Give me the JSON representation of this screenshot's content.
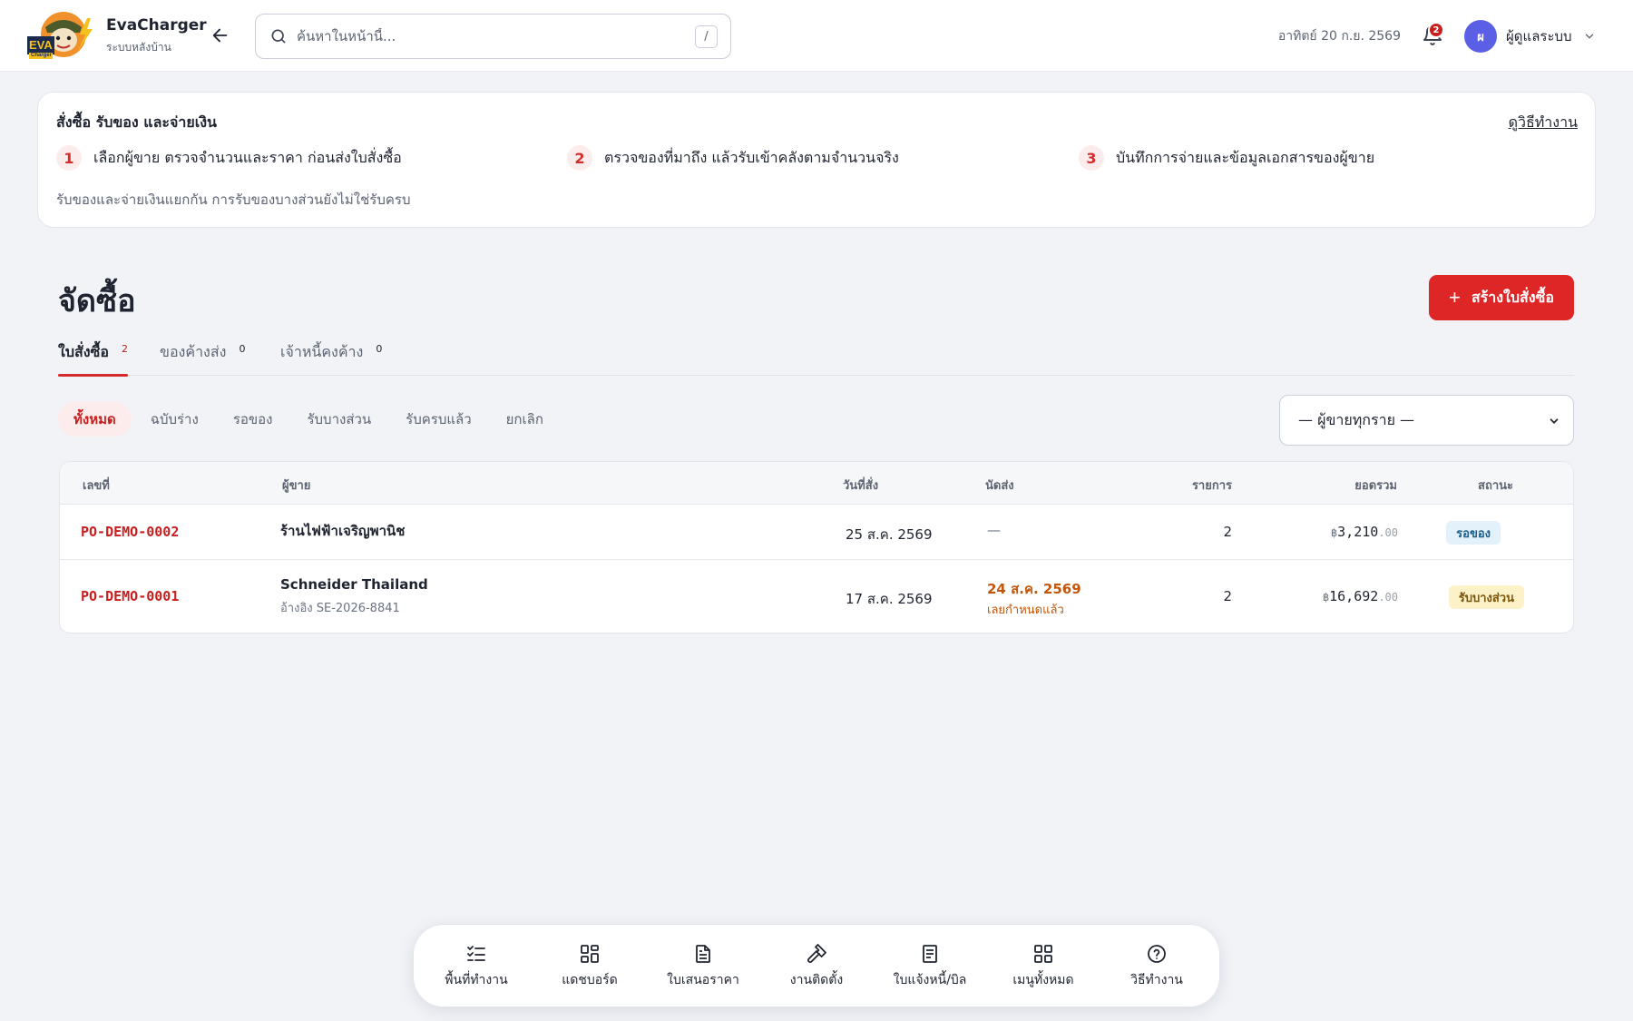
{
  "brand": {
    "name": "EvaCharger",
    "subtitle": "ระบบหลังบ้าน",
    "logo_text": "EVA",
    "logo_subtext": "Charger"
  },
  "search": {
    "placeholder": "ค้นหาในหน้านี้...",
    "value": "",
    "shortcut": "/"
  },
  "header": {
    "date": "อาทิตย์ 20 ก.ย. 2569",
    "notification_count": "2",
    "user_initial": "ผ",
    "user_name": "ผู้ดูแลระบบ"
  },
  "guide": {
    "title": "สั่งซื้อ รับของ และจ่ายเงิน",
    "link": "ดูวิธีทำงาน",
    "steps": [
      {
        "num": "1",
        "text": "เลือกผู้ขาย ตรวจจำนวนและราคา ก่อนส่งใบสั่งซื้อ"
      },
      {
        "num": "2",
        "text": "ตรวจของที่มาถึง แล้วรับเข้าคลังตามจำนวนจริง"
      },
      {
        "num": "3",
        "text": "บันทึกการจ่ายและข้อมูลเอกสารของผู้ขาย"
      }
    ],
    "note": "รับของและจ่ายเงินแยกกัน การรับของบางส่วนยังไม่ใช่รับครบ"
  },
  "page": {
    "title": "จัดซื้อ",
    "create_button": "สร้างใบสั่งซื้อ",
    "create_icon": "+"
  },
  "tabs": [
    {
      "label": "ใบสั่งซื้อ",
      "count": "2"
    },
    {
      "label": "ของค้างส่ง",
      "count": "0"
    },
    {
      "label": "เจ้าหนี้คงค้าง",
      "count": "0"
    }
  ],
  "filters": [
    "ทั้งหมด",
    "ฉบับร่าง",
    "รอของ",
    "รับบางส่วน",
    "รับครบแล้ว",
    "ยกเลิก"
  ],
  "vendor_select": {
    "selected": "— ผู้ขายทุกราย —"
  },
  "table": {
    "headers": {
      "number": "เลขที่",
      "vendor": "ผู้ขาย",
      "order_date": "วันที่สั่ง",
      "due_date": "นัดส่ง",
      "items": "รายการ",
      "total": "ยอดรวม",
      "status": "สถานะ"
    },
    "rows": [
      {
        "number": "PO-DEMO-0002",
        "vendor": "ร้านไฟฟ้าเจริญพานิช",
        "vendor_ref": "",
        "order_date": "25 ส.ค. 2569",
        "due_date": "—",
        "due_note": "",
        "items": "2",
        "currency": "฿",
        "total_int": "3,210",
        "total_dec": ".00",
        "status": "รอของ"
      },
      {
        "number": "PO-DEMO-0001",
        "vendor": "Schneider Thailand",
        "vendor_ref": "อ้างอิง SE-2026-8841",
        "order_date": "17 ส.ค. 2569",
        "due_date": "24 ส.ค. 2569",
        "due_note": "เลยกำหนดแล้ว",
        "items": "2",
        "currency": "฿",
        "total_int": "16,692",
        "total_dec": ".00",
        "status": "รับบางส่วน"
      }
    ]
  },
  "bottom_nav": [
    {
      "label": "พื้นที่ทำงาน",
      "icon": "checklist-icon"
    },
    {
      "label": "แดชบอร์ด",
      "icon": "grid-icon"
    },
    {
      "label": "ใบเสนอราคา",
      "icon": "document-icon"
    },
    {
      "label": "งานติดตั้ง",
      "icon": "hammer-icon"
    },
    {
      "label": "ใบแจ้งหนี้/บิล",
      "icon": "receipt-icon"
    },
    {
      "label": "เมนูทั้งหมด",
      "icon": "apps-icon"
    },
    {
      "label": "วิธีทำงาน",
      "icon": "help-icon"
    }
  ],
  "colors": {
    "accent": "#de2626",
    "accent_soft": "#fdecec",
    "late": "#c2570c",
    "avatar": "#5b5fe6"
  }
}
